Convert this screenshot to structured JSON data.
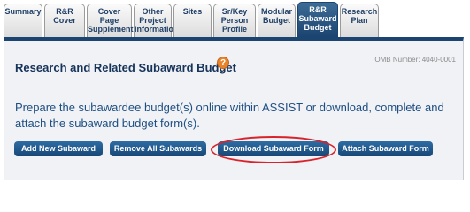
{
  "tabs": [
    {
      "label": "Summary",
      "active": false
    },
    {
      "label": "R&R Cover",
      "active": false
    },
    {
      "label": "Cover Page\nSupplement",
      "active": false
    },
    {
      "label": "Other\nProject\nInformation",
      "active": false
    },
    {
      "label": "Sites",
      "active": false
    },
    {
      "label": "Sr/Key\nPerson\nProfile",
      "active": false
    },
    {
      "label": "Modular\nBudget",
      "active": false
    },
    {
      "label": "R&R\nSubaward\nBudget",
      "active": true
    },
    {
      "label": "Research\nPlan",
      "active": false
    }
  ],
  "page": {
    "title": "Research and Related Subaward Budget",
    "help_icon": "question-mark-icon",
    "omb_number": "OMB Number: 4040-0001",
    "description": "Prepare the subawardee budget(s) online within ASSIST or download, complete and attach the subaward budget form(s)."
  },
  "buttons": {
    "add_new": "Add New Subaward",
    "remove_all": "Remove All Subawards",
    "download": "Download Subaward Form",
    "attach": "Attach Subaward Form"
  },
  "colors": {
    "active_tab": "#1b4470",
    "button": "#1f5a8f",
    "highlight_oval": "#d8232a",
    "help_icon": "#e8842a"
  }
}
